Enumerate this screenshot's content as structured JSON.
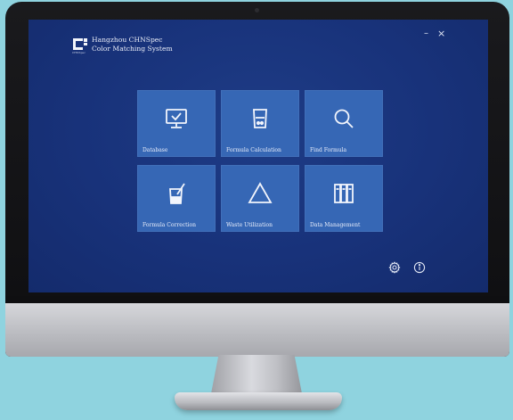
{
  "app": {
    "title_line1": "Hangzhou CHNSpec",
    "title_line2": "Color Matching System",
    "logo_text": "CHNSpec"
  },
  "window_controls": {
    "minimize": "–",
    "close": "×"
  },
  "tiles": [
    {
      "label": "Database",
      "icon": "monitor-check-icon"
    },
    {
      "label": "Formula Calculation",
      "icon": "beaker-icon"
    },
    {
      "label": "Find Formula",
      "icon": "search-icon"
    },
    {
      "label": "Formula Correction",
      "icon": "mixing-beaker-icon"
    },
    {
      "label": "Waste Utilization",
      "icon": "triangle-icon"
    },
    {
      "label": "Data Management",
      "icon": "binders-icon"
    }
  ],
  "footer": {
    "settings_icon": "gear-icon",
    "info_icon": "info-icon"
  },
  "colors": {
    "screen_bg": "#18327a",
    "tile_bg": "#3667b5",
    "backdrop": "#8fd3df"
  }
}
